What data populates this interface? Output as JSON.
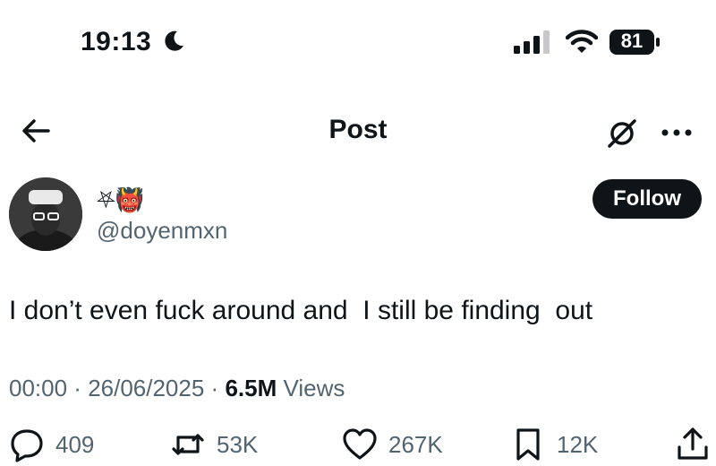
{
  "status_bar": {
    "time": "19:13",
    "battery": "81",
    "icons": [
      "moon-icon",
      "signal-icon",
      "wifi-icon",
      "battery-icon"
    ]
  },
  "header": {
    "title": "Post",
    "icons": [
      "back-arrow-icon",
      "grok-icon",
      "more-icon"
    ]
  },
  "author": {
    "display_name": "⛧👹",
    "handle": "@doyenmxn",
    "follow_label": "Follow"
  },
  "tweet": {
    "text": "I don’t even fuck around and  I still be finding  out",
    "time": "00:00",
    "date": "26/06/2025",
    "views_count": "6.5M",
    "views_label": "Views"
  },
  "actions": {
    "replies": "409",
    "reposts": "53K",
    "likes": "267K",
    "bookmarks": "12K",
    "icons": [
      "reply-icon",
      "repost-icon",
      "like-icon",
      "bookmark-icon",
      "share-icon"
    ]
  },
  "colors": {
    "text": "#0f1419",
    "secondary": "#536471",
    "button": "#0f1419",
    "background": "#ffffff"
  }
}
